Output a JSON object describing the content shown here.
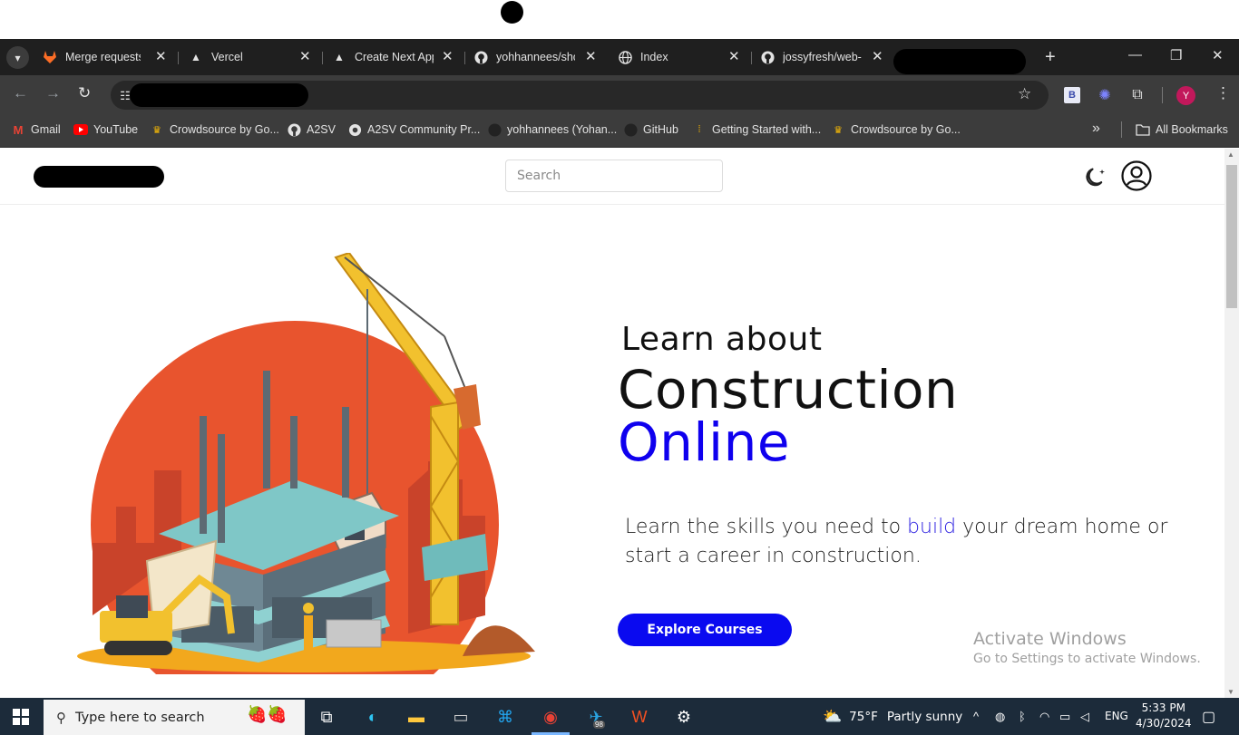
{
  "tabs": [
    {
      "label": "Merge requests",
      "icon": "gitlab-icon"
    },
    {
      "label": "Vercel",
      "icon": "vercel-icon"
    },
    {
      "label": "Create Next App",
      "icon": "vercel-icon"
    },
    {
      "label": "yohhannees/sho",
      "icon": "github-icon"
    },
    {
      "label": "Index",
      "icon": "globe-icon"
    },
    {
      "label": "jossyfresh/web-p",
      "icon": "github-icon"
    }
  ],
  "bookmarks": [
    {
      "label": "Gmail"
    },
    {
      "label": "YouTube"
    },
    {
      "label": "Crowdsource by Go..."
    },
    {
      "label": "A2SV"
    },
    {
      "label": "A2SV Community Pr..."
    },
    {
      "label": "yohhannees (Yohan..."
    },
    {
      "label": "GitHub"
    },
    {
      "label": "Getting Started with..."
    },
    {
      "label": "Crowdsource by Go..."
    }
  ],
  "bookmarks_all": "All Bookmarks",
  "profile_initial": "Y",
  "ext_b_label": "B",
  "site": {
    "search_placeholder": "Search"
  },
  "hero": {
    "line1": "Learn about",
    "line2": "Construction",
    "line3": "Online",
    "lead_before": "Learn the skills you need to ",
    "lead_highlight": "build",
    "lead_after": " your dream home or start a career in construction.",
    "cta": "Explore Courses",
    "accent_color": "#0f00ee"
  },
  "watermark": {
    "title": "Activate Windows",
    "subtitle": "Go to Settings to activate Windows."
  },
  "taskbar": {
    "search_placeholder": "Type here to search",
    "telegram_badge": "98",
    "weather_temp": "75°F",
    "weather_desc": "Partly sunny",
    "lang": "ENG",
    "time": "5:33 PM",
    "date": "4/30/2024"
  }
}
